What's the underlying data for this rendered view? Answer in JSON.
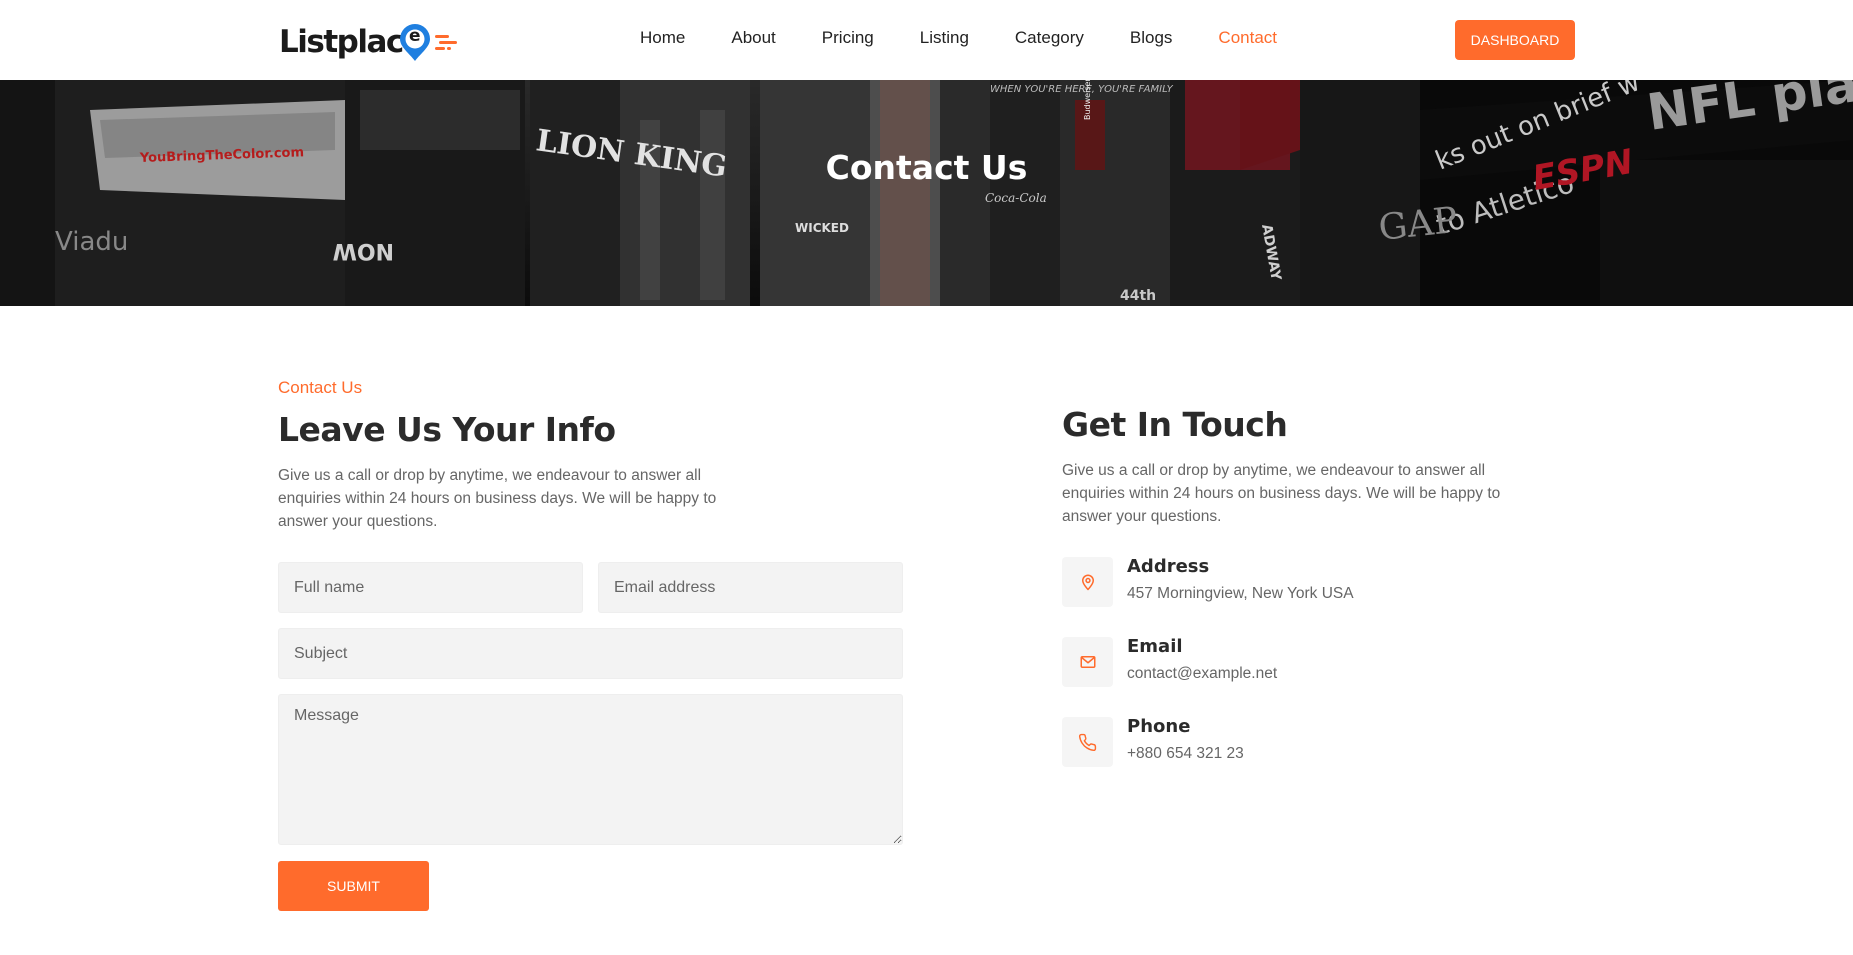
{
  "brand": {
    "logo_text": "Listplac",
    "logo_letter": "e",
    "accent": "#ff6b2c",
    "logo_pin_color": "#1f7fe0"
  },
  "nav": {
    "items": [
      {
        "label": "Home"
      },
      {
        "label": "About"
      },
      {
        "label": "Pricing"
      },
      {
        "label": "Listing"
      },
      {
        "label": "Category"
      },
      {
        "label": "Blogs"
      },
      {
        "label": "Contact",
        "active": true
      }
    ],
    "dashboard_label": "DASHBOARD"
  },
  "hero": {
    "title": "Contact Us",
    "signage": {
      "sign_1": "YouBringTheColor.com",
      "sign_2": "NFL play",
      "sign_3": "ks out on brief w",
      "sign_4": "to Atletico",
      "sign_5": "ESPN",
      "sign_6": "GAP",
      "sign_7": "Viadu",
      "sign_8": "NOW",
      "sign_9": "WICKED",
      "sign_10": "44th",
      "sign_11": "WHEN YOU'RE HERE, YOU'RE FAMILY",
      "sign_12": "Budweiser",
      "sign_13": "LION KING",
      "sign_14": "ADWAY",
      "sign_15": "Coca-Cola"
    }
  },
  "form_section": {
    "eyebrow": "Contact Us",
    "heading": "Leave Us Your Info",
    "description": "Give us a call or drop by anytime, we endeavour to answer all enquiries within 24 hours on business days. We will be happy to answer your questions.",
    "fullname_placeholder": "Full name",
    "email_placeholder": "Email address",
    "subject_placeholder": "Subject",
    "message_placeholder": "Message",
    "submit_label": "SUBMIT"
  },
  "touch_section": {
    "heading": "Get In Touch",
    "description": "Give us a call or drop by anytime, we endeavour to answer all enquiries within 24 hours on business days. We will be happy to answer your questions.",
    "items": [
      {
        "icon": "map-pin-icon",
        "label": "Address",
        "value": "457 Morningview, New York USA"
      },
      {
        "icon": "envelope-icon",
        "label": "Email",
        "value": "contact@example.net"
      },
      {
        "icon": "phone-icon",
        "label": "Phone",
        "value": "+880 654 321 23"
      }
    ]
  }
}
